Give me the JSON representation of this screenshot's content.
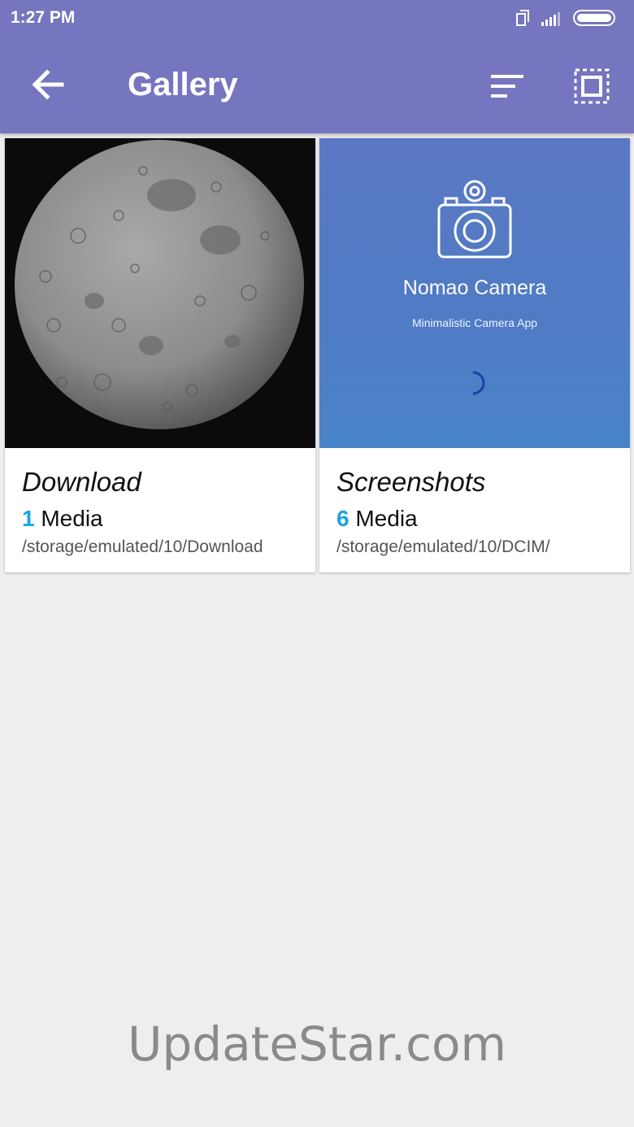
{
  "status_bar": {
    "time": "1:27 PM"
  },
  "app_bar": {
    "title": "Gallery"
  },
  "albums": [
    {
      "name": "Download",
      "count": "1",
      "count_suffix": " Media",
      "path": "/storage/emulated/10/Download"
    },
    {
      "name": "Screenshots",
      "count": "6",
      "count_suffix": " Media",
      "path": "/storage/emulated/10/DCIM/"
    }
  ],
  "screenshot_preview": {
    "app_name": "Nomao Camera",
    "tagline": "Minimalistic Camera App"
  },
  "watermark": "UpdateStar.com",
  "colors": {
    "app_bar": "#7675bf",
    "accent": "#1aa3e6",
    "background": "#eeeeee"
  }
}
